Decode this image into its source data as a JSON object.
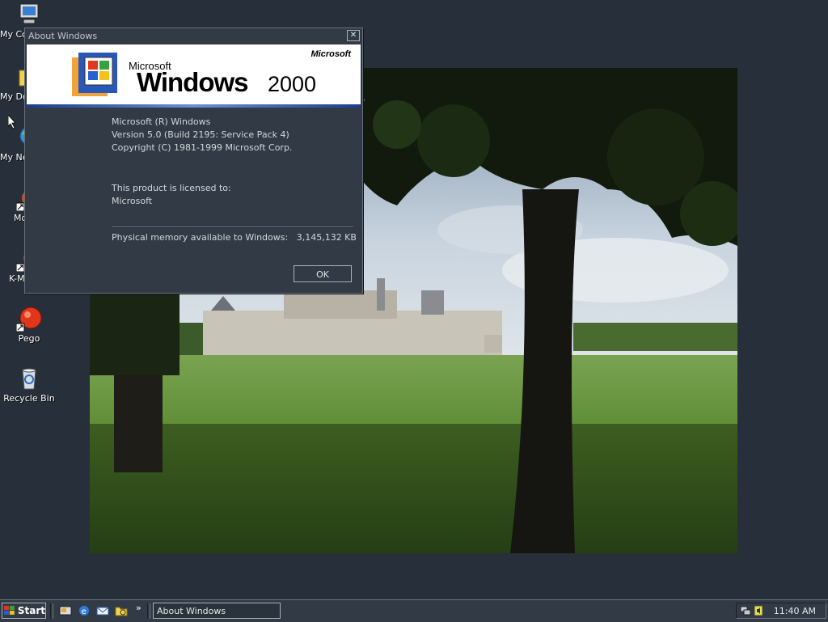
{
  "desktop": {
    "icons": [
      {
        "label": "My Computer",
        "icon": "computer-icon"
      },
      {
        "label": "My Documents",
        "icon": "documents-folder-icon"
      },
      {
        "label": "My Network Places",
        "icon": "network-places-icon"
      },
      {
        "label": "Mozilla",
        "icon": "mozilla-icon"
      },
      {
        "label": "K-Meleon",
        "icon": "k-meleon-icon"
      },
      {
        "label": "Pego",
        "icon": "pego-icon"
      },
      {
        "label": "Recycle Bin",
        "icon": "recycle-bin-icon"
      }
    ],
    "wallpaper": "chateau-with-trees-photo"
  },
  "dialog": {
    "title": "About Windows",
    "close_glyph": "✕",
    "banner": {
      "microsoft_top": "Microsoft",
      "microsoft_small": "Microsoft",
      "windows_word": "Windows",
      "version_word": "2000"
    },
    "lines": [
      "Microsoft (R) Windows",
      "Version 5.0 (Build 2195: Service Pack 4)",
      "Copyright (C) 1981-1999 Microsoft Corp."
    ],
    "licensed_label": "This product is licensed to:",
    "licensed_to": "Microsoft",
    "memory_label": "Physical memory available to Windows:",
    "memory_value": "3,145,132 KB",
    "ok_label": "OK"
  },
  "taskbar": {
    "start_label": "Start",
    "quick_launch": [
      "show-desktop-icon",
      "internet-explorer-icon",
      "outlook-express-icon",
      "windows-explorer-icon"
    ],
    "more_glyph": "»",
    "task_label": "About Windows",
    "tray_icons": [
      "network-icon",
      "volume-icon"
    ],
    "clock": "11:40 AM"
  },
  "colors": {
    "desktop_bg": "#27303a",
    "dialog_bg": "#323b45",
    "banner_stripe": "#1b3d8e"
  }
}
